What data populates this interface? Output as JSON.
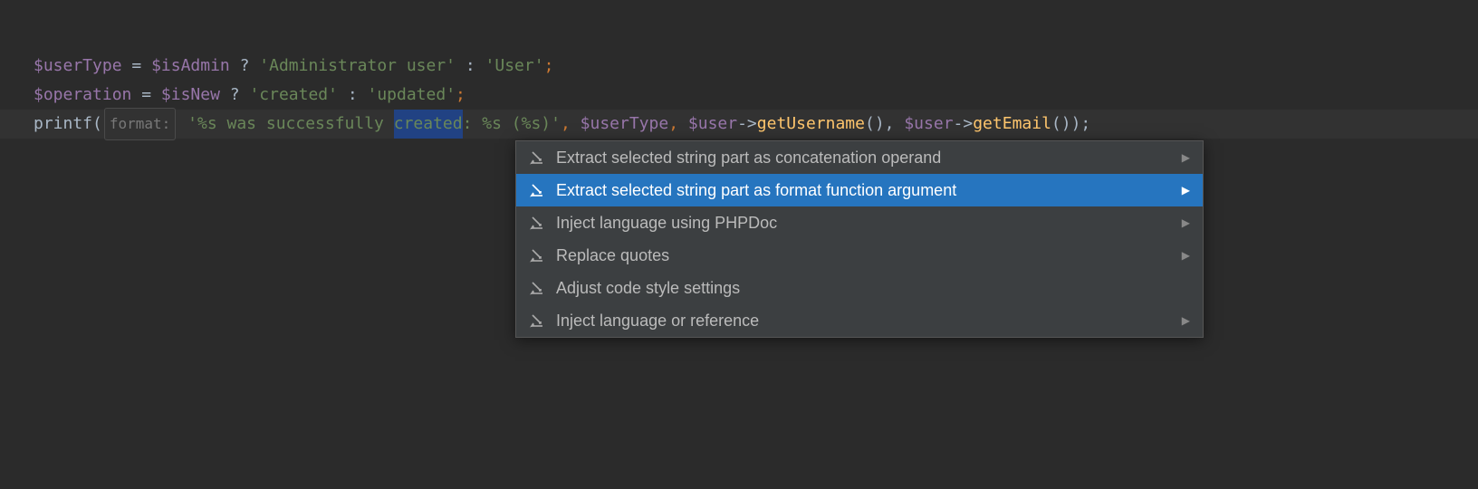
{
  "code": {
    "line1": {
      "var1": "$userType",
      "assign": " = ",
      "var2": "$isAdmin",
      "tern1": " ? ",
      "str1": "'Administrator user'",
      "tern2": " : ",
      "str2": "'User'",
      "semi": ";"
    },
    "line2": {
      "var1": "$operation",
      "assign": " = ",
      "var2": "$isNew",
      "tern1": " ? ",
      "str1": "'created'",
      "tern2": " : ",
      "str2": "'updated'",
      "semi": ";"
    },
    "line3": {
      "fn": "printf",
      "paren1": "(",
      "hint": "format:",
      "str_start": "'%s was successfully ",
      "selected": "created",
      "str_end": ": %s (%s)'",
      "comma1": ", ",
      "var1": "$userType",
      "comma2": ", ",
      "var2": "$user",
      "arrow1": "->",
      "method1": "getUsername",
      "call1": "(), ",
      "var3": "$user",
      "arrow2": "->",
      "method2": "getEmail",
      "call2": "());"
    }
  },
  "popup": {
    "items": [
      {
        "label": "Extract selected string part as concatenation operand",
        "submenu": true,
        "selected": false
      },
      {
        "label": "Extract selected string part as format function argument",
        "submenu": true,
        "selected": true
      },
      {
        "label": "Inject language using PHPDoc",
        "submenu": true,
        "selected": false
      },
      {
        "label": "Replace quotes",
        "submenu": true,
        "selected": false
      },
      {
        "label": "Adjust code style settings",
        "submenu": false,
        "selected": false
      },
      {
        "label": "Inject language or reference",
        "submenu": true,
        "selected": false
      }
    ]
  }
}
